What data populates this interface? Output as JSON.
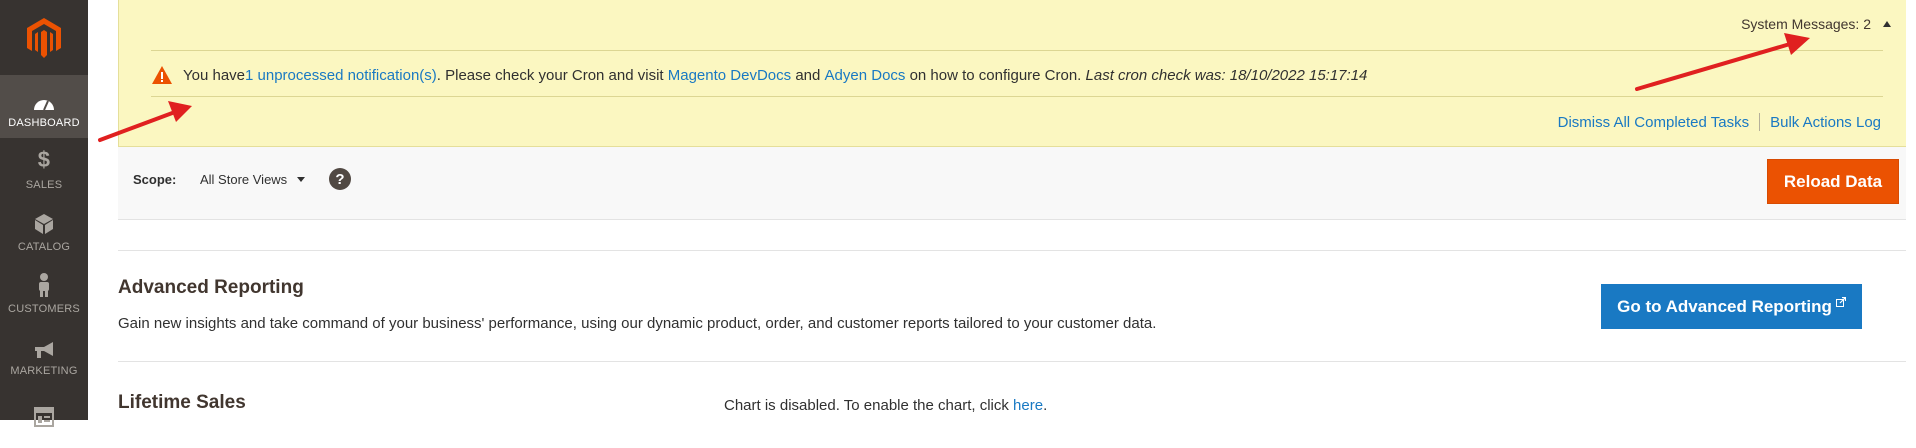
{
  "sidebar": {
    "items": [
      {
        "label": "DASHBOARD",
        "icon": "dashboard-icon",
        "active": true
      },
      {
        "label": "SALES",
        "icon": "dollar-icon"
      },
      {
        "label": "CATALOG",
        "icon": "box-icon"
      },
      {
        "label": "CUSTOMERS",
        "icon": "person-icon"
      },
      {
        "label": "MARKETING",
        "icon": "megaphone-icon"
      },
      {
        "label": "",
        "icon": "content-icon"
      }
    ]
  },
  "system_messages": {
    "header": "System Messages: 2",
    "message": {
      "prefix": "You have ",
      "notifications_link": "1 unprocessed notification(s)",
      "mid1": ". Please check your Cron and visit ",
      "devdocs_link": "Magento DevDocs",
      "mid2": " and ",
      "adyen_link": "Adyen Docs",
      "mid3": " on how to configure Cron. ",
      "last_check": "Last cron check was: 18/10/2022 15:17:14"
    },
    "actions": {
      "dismiss": "Dismiss All Completed Tasks",
      "bulk_log": "Bulk Actions Log"
    }
  },
  "scope": {
    "label": "Scope:",
    "value": "All Store Views",
    "help": "?",
    "reload": "Reload Data"
  },
  "advanced_reporting": {
    "title": "Advanced Reporting",
    "description": "Gain new insights and take command of your business' performance, using our dynamic product, order, and customer reports tailored to your customer data.",
    "button": "Go to Advanced Reporting"
  },
  "lifetime_sales": {
    "title": "Lifetime Sales",
    "chart_message": "Chart is disabled. To enable the chart, click ",
    "chart_link": "here",
    "chart_suffix": "."
  },
  "colors": {
    "sidebar": "#373330",
    "accent_orange": "#eb5202",
    "link_blue": "#1979c3",
    "notice_yellow": "#fbf7c1",
    "annotation_red": "#e02020"
  }
}
